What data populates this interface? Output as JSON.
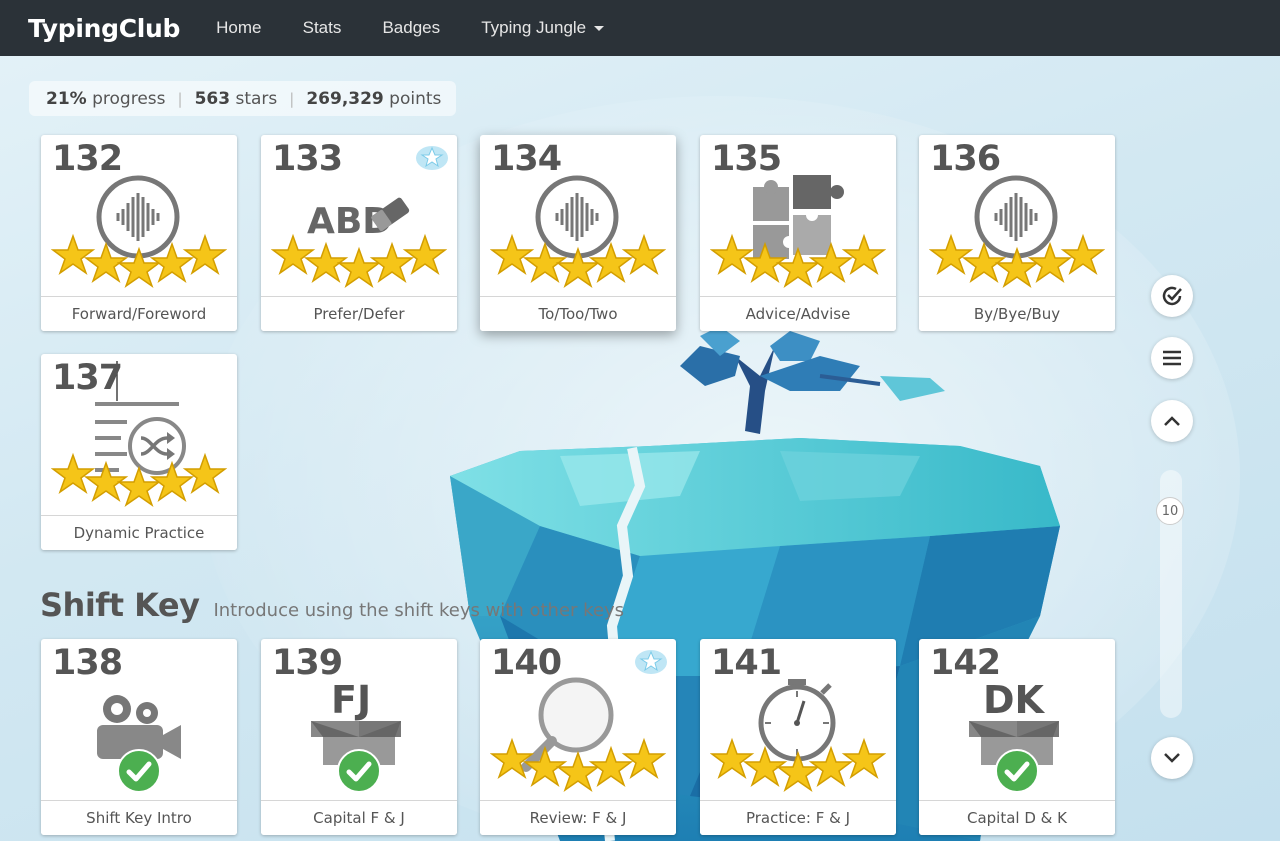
{
  "nav": {
    "brand": "TypingClub",
    "items": [
      "Home",
      "Stats",
      "Badges"
    ],
    "dropdown": "Typing Jungle"
  },
  "stats": {
    "progress_value": "21%",
    "progress_label": "progress",
    "stars_value": "563",
    "stars_label": "stars",
    "points_value": "269,329",
    "points_label": "points"
  },
  "lessons": [
    {
      "number": "132",
      "label": "Forward/Foreword",
      "icon": "audio-icon",
      "stars": 5
    },
    {
      "number": "133",
      "label": "Prefer/Defer",
      "icon": "eraser-icon",
      "icon_text": "ABD",
      "stars": 5,
      "badge": "star-badge-icon"
    },
    {
      "number": "134",
      "label": "To/Too/Two",
      "icon": "audio-icon",
      "stars": 5
    },
    {
      "number": "135",
      "label": "Advice/Advise",
      "icon": "puzzle-icon",
      "stars": 5
    },
    {
      "number": "136",
      "label": "By/Bye/Buy",
      "icon": "audio-icon",
      "stars": 5
    },
    {
      "number": "137",
      "label": "Dynamic Practice",
      "icon": "shuffle-icon",
      "stars": 5
    }
  ],
  "section": {
    "title": "Shift Key",
    "subtitle": "Introduce using the shift keys with other keys"
  },
  "section_lessons": [
    {
      "number": "138",
      "label": "Shift Key Intro",
      "icon": "video-camera-icon",
      "completed": true
    },
    {
      "number": "139",
      "label": "Capital F & J",
      "icon": "box-icon",
      "icon_text": "FJ",
      "completed": true
    },
    {
      "number": "140",
      "label": "Review: F & J",
      "icon": "magnifier-icon",
      "stars": 5,
      "badge": "star-badge-icon"
    },
    {
      "number": "141",
      "label": "Practice: F & J",
      "icon": "stopwatch-icon",
      "stars": 5
    },
    {
      "number": "142",
      "label": "Capital D & K",
      "icon": "box-icon",
      "icon_text": "DK",
      "completed": true
    }
  ],
  "sidebar": {
    "zoom_value": "10"
  },
  "colors": {
    "topbar": "#2b3238",
    "star": "#f5c518",
    "check": "#4caf50",
    "crystal": "#2a9cbf"
  }
}
